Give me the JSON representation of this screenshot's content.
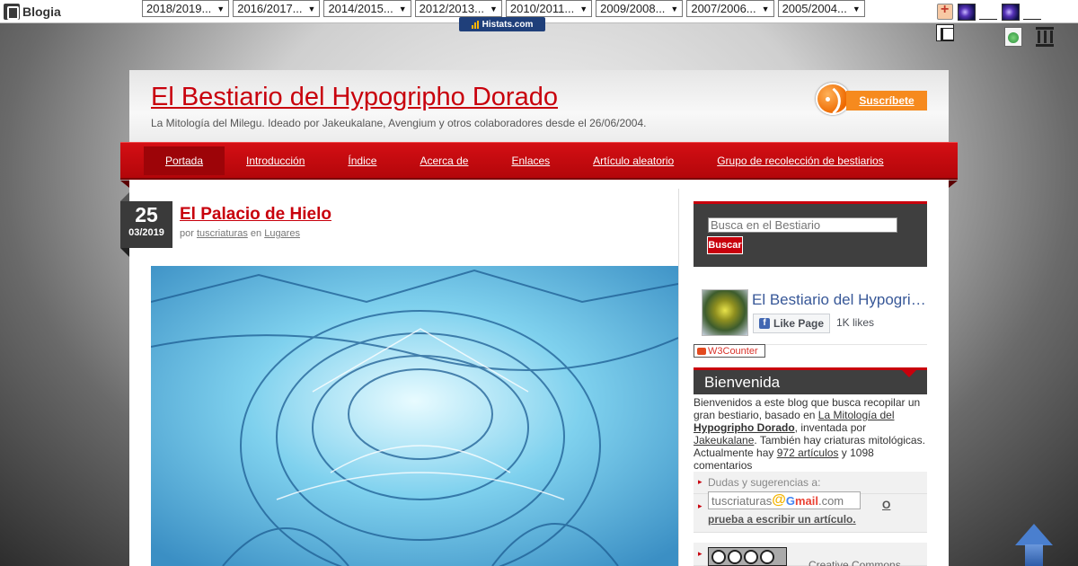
{
  "toolbar": {
    "logo_text": "Blogia",
    "years": [
      "2018/2019...",
      "2016/2017...",
      "2014/2015...",
      "2012/2013...",
      "2010/2011...",
      "2009/2008...",
      "2007/2006...",
      "2005/2004..."
    ],
    "histats_label": "Histats.com"
  },
  "header": {
    "title": "El Bestiario del Hypogripho Dorado",
    "subtitle": "La Mitología del Milegu. Ideado por Jakeukalane, Avengium y otros colaboradores desde el 26/06/2004.",
    "subscribe_label": "Suscríbete"
  },
  "nav": {
    "items": [
      "Portada",
      "Introducción",
      "Índice",
      "Acerca de",
      "Enlaces",
      "Artículo aleatorio",
      "Grupo de recolección de bestiarios"
    ],
    "active_index": 0
  },
  "post": {
    "day": "25",
    "month_year": "03/2019",
    "title": "El Palacio de Hielo",
    "meta_prefix": "por",
    "author": "tuscriaturas",
    "meta_mid": "en",
    "category": "Lugares"
  },
  "sidebar": {
    "search_placeholder": "Busca en el Bestiario",
    "search_button": "Buscar",
    "fb_page_name": "El Bestiario del Hypogripho Dorado",
    "fb_like_label": "Like Page",
    "fb_likes": "1K likes",
    "w3counter_label": "W3Counter",
    "welcome_title": "Bienvenida",
    "welcome": {
      "t1": "Bienvenidos a este blog que busca recopilar un gran bestiario, basado en ",
      "link1": "La Mitología del",
      "link2": "Hypogripho Dorado",
      "t2": ", inventada por ",
      "link3": "Jakeukalane",
      "t3": ". También hay criaturas mitológicas. Actualmente hay ",
      "link4": "972 artículos",
      "t4": " y 1098 comentarios"
    },
    "doubts_label": "Dudas y sugerencias a:",
    "email_user": "tuscriaturas",
    "email_domain_g": "G",
    "email_domain_m": "mail",
    "email_tld": ".com",
    "or_label": "O",
    "try_label": "prueba a escribir un artículo.",
    "cc_text": "Creative Commons"
  },
  "colors": {
    "accent_red": "#c8000c",
    "nav_red": "#d40f14",
    "rss_orange": "#f68a1e",
    "sidebar_dark": "#3f3f3f"
  },
  "icons": [
    "blogia-logo-icon",
    "plus-icon",
    "galaxy-icon",
    "book-icon",
    "globe-icon",
    "columns-icon",
    "rss-icon",
    "facebook-icon",
    "scroll-to-top-icon",
    "creative-commons-icon"
  ]
}
